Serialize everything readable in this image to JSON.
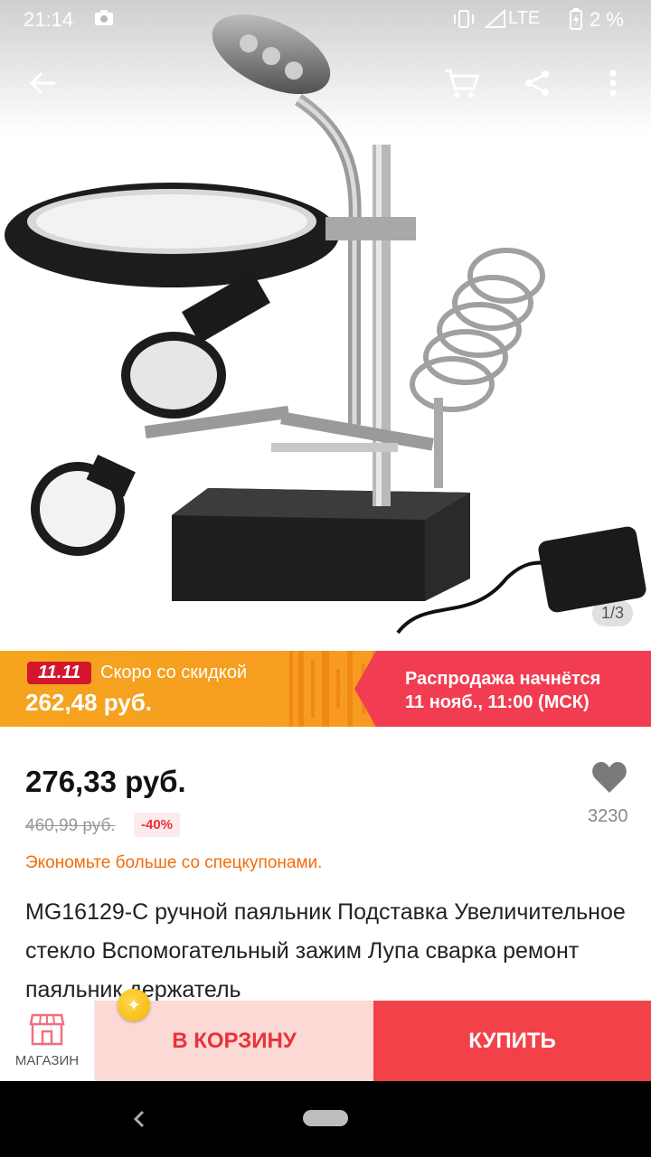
{
  "status": {
    "time": "21:14",
    "network": "LTE",
    "battery": "2 %"
  },
  "gallery": {
    "page_indicator": "1/3"
  },
  "promo": {
    "badge": "11.11",
    "soon_text": "Скоро со скидкой",
    "promo_price": "262,48 руб.",
    "sale_line1": "Распродажа начнётся",
    "sale_line2": "11 нояб., 11:00 (МСК)"
  },
  "product": {
    "price": "276,33 руб.",
    "old_price": "460,99 руб.",
    "discount": "-40%",
    "coupon_text": "Экономьте больше со спецкупонами.",
    "favorites_count": "3230",
    "title": "MG16129-C ручной паяльник Подставка Увеличительное стекло Вспомогательный зажим Лупа сварка ремонт паяльник держатель"
  },
  "actions": {
    "shop_label": "МАГАЗИН",
    "cart_label": "В КОРЗИНУ",
    "buy_label": "КУПИТЬ"
  },
  "colors": {
    "promo_orange": "#f79a21",
    "promo_red": "#f23c52",
    "buy_red": "#f34149",
    "cart_pink": "#fcd9d4",
    "coupon_orange": "#f36c0b"
  },
  "icons": [
    "back-arrow-icon",
    "cart-icon",
    "share-icon",
    "more-vert-icon",
    "heart-icon",
    "shop-icon",
    "coin-icon",
    "nav-back-icon",
    "home-pill-icon"
  ]
}
